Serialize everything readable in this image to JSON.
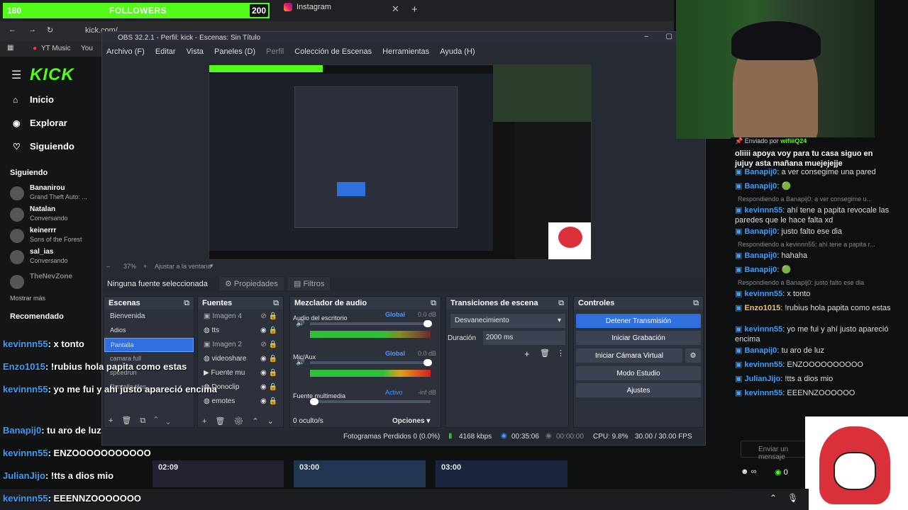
{
  "follow_bar": {
    "count": "180",
    "label": "FOLLOWERS",
    "goal": "200",
    "progress": 0.9
  },
  "browser": {
    "tab_title": "Instagram",
    "url": "kick.com/...",
    "bookmarks": [
      "YT Music",
      "You"
    ]
  },
  "kick": {
    "logo": "KICK",
    "nav": [
      {
        "label": "Inicio"
      },
      {
        "label": "Explorar"
      },
      {
        "label": "Siguiendo"
      }
    ],
    "following_header": "Siguiendo",
    "following": [
      {
        "name": "Bananirou",
        "game": "Grand Theft Auto: ..."
      },
      {
        "name": "Natalan",
        "game": "Conversando"
      },
      {
        "name": "keinerrr",
        "game": "Sons of the Forest"
      },
      {
        "name": "sal_ias",
        "game": "Conversando"
      },
      {
        "name": "TheNevZone",
        "game": ""
      }
    ],
    "show_more": "Mostrar más",
    "recommended_header": "Recomendado"
  },
  "obs": {
    "title": "OBS 32.2.1 - Perfil: kick - Escenas: Sin Título",
    "menu": [
      "Archivo (F)",
      "Editar",
      "Vista",
      "Paneles (D)",
      "Perfil",
      "Colección de Escenas",
      "Herramientas",
      "Ayuda (H)"
    ],
    "no_source": "Ninguna fuente seleccionada",
    "props": "Propiedades",
    "filters": "Filtros",
    "scenes_hdr": "Escenas",
    "scenes": [
      "Bienvenida",
      "Adios",
      "Pantalla",
      "camara full",
      "speedrun",
      "Pantalla tiles"
    ],
    "sources_hdr": "Fuentes",
    "sources": [
      "Imagen 4",
      "tts",
      "Imagen 2",
      "videoshare",
      "Fuente mu",
      "Donoclip",
      "emotes"
    ],
    "mixer_hdr": "Mezclador de audio",
    "mixer": [
      {
        "name": "Audio del escritorio",
        "tag": "Global",
        "db": "0.0 dB"
      },
      {
        "name": "Mic/Aux",
        "tag": "Global",
        "db": "0.0 dB"
      },
      {
        "name": "Fuente multimedia",
        "tag": "Activo",
        "db": "-inf dB"
      }
    ],
    "mixer_scale": [
      "-60",
      "-45",
      "-35",
      "-25",
      "-20",
      "-15",
      "-10",
      "-5",
      "0"
    ],
    "hidden": "0 oculto/s",
    "options": "Opciones",
    "trans_hdr": "Transiciones de escena",
    "transition": "Desvanecimiento",
    "duration_label": "Duración",
    "duration": "2000 ms",
    "controls_hdr": "Controles",
    "controls": [
      "Detener Transmisión",
      "Iniciar Grabación",
      "Iniciar Cámara Virtual",
      "Modo Estudio",
      "Ajustes"
    ],
    "status": {
      "dropped": "Fotogramas Perdidos 0 (0.0%)",
      "kbps": "4168 kbps",
      "live": "00:35:06",
      "rec": "00:00:00",
      "cpu": "CPU: 9.8%",
      "fps": "30.00 / 30.00 FPS"
    },
    "zoom": "37%",
    "fit": "Ajustar a la ventana"
  },
  "chat": {
    "pinned_by": "Enviado por",
    "pinned_user": "wifiiiQ24",
    "pinned_text": "oliiii apoya voy para tu casa siguo en jujuy asta mañana muejejejje",
    "messages": [
      {
        "u": "Banapij0",
        "t": "a ver consegime una pared",
        "c": "#3aa0ff"
      },
      {
        "u": "Banapij0",
        "t": "🟢",
        "c": "#3aa0ff"
      },
      {
        "reply": "Respondiendo a Banapij0: a ver consegime u..."
      },
      {
        "u": "kevinnn55",
        "t": "ahí tene a papita revocale las paredes que le hace falta xd",
        "c": "#3aa0ff"
      },
      {
        "u": "Banapij0",
        "t": "justo falto ese dia",
        "c": "#3aa0ff"
      },
      {
        "reply": "Respondiendo a kevinnn55: ahí tene a papita r..."
      },
      {
        "u": "Banapij0",
        "t": "hahaha",
        "c": "#3aa0ff"
      },
      {
        "u": "Banapij0",
        "t": "🟢",
        "c": "#3aa0ff"
      },
      {
        "reply": "Respondiendo a Banapij0: justo falto ese dia"
      },
      {
        "u": "kevinnn55",
        "t": "x tonto",
        "c": "#3aa0ff"
      },
      {
        "u": "Enzo1015",
        "t": "!rubius hola papita como estas",
        "c": "#e9c46a"
      },
      {
        "u": "kevinnn55",
        "t": "yo me fui y ahí justo apareció encima",
        "c": "#3aa0ff"
      },
      {
        "u": "Banapij0",
        "t": "tu aro de luz",
        "c": "#3aa0ff"
      },
      {
        "u": "kevinnn55",
        "t": "ENZOOOOOOOOOO",
        "c": "#3aa0ff"
      },
      {
        "u": "JulianJijo",
        "t": "!tts a dios mio",
        "c": "#3aa0ff"
      },
      {
        "u": "kevinnn55",
        "t": "EEENNZOOOOOO",
        "c": "#3aa0ff"
      }
    ],
    "input_placeholder": "Enviar un mensaje"
  },
  "overlay": [
    {
      "u": "kevinnn55",
      "t": ": x tonto"
    },
    {
      "u": "Enzo1015",
      "t": ": !rubius hola papita como estas"
    },
    {
      "u": "kevinnn55",
      "t": ": yo me fui y ahí justo apareció encima"
    },
    {
      "u": "Banapij0",
      "t": ": tu aro de luz"
    },
    {
      "u": "kevinnn55",
      "t": ": ENZOOOOOOOOOOO"
    },
    {
      "u": "JulianJijo",
      "t": ": !tts a dios mio"
    },
    {
      "u": "kevinnn55",
      "t": ": EEENNZOOOOOOO"
    }
  ],
  "thumbs": [
    "02:09",
    "03:00",
    "03:00"
  ],
  "colors": {
    "kick_green": "#53fc18",
    "obs_accent": "#2f6fde"
  }
}
